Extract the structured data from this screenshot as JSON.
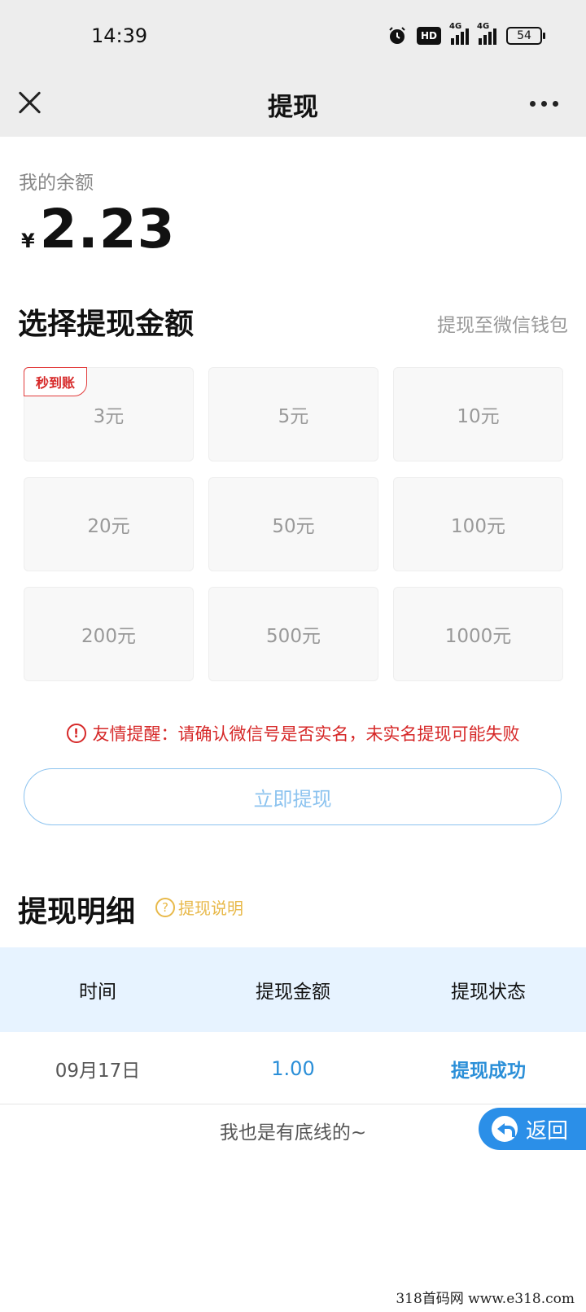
{
  "status_bar": {
    "time": "14:39",
    "hd_label": "HD",
    "net1": "4G",
    "net2": "4G",
    "battery": "54"
  },
  "nav": {
    "title": "提现"
  },
  "balance": {
    "label": "我的余额",
    "currency": "¥",
    "amount": "2.23"
  },
  "select": {
    "title": "选择提现金额",
    "destination": "提现至微信钱包",
    "instant_tag": "秒到账"
  },
  "options": [
    "3元",
    "5元",
    "10元",
    "20元",
    "50元",
    "100元",
    "200元",
    "500元",
    "1000元"
  ],
  "warning": {
    "icon": "!",
    "text": "友情提醒：请确认微信号是否实名，未实名提现可能失败"
  },
  "withdraw_button": "立即提现",
  "records": {
    "title": "提现明细",
    "help": "提现说明",
    "help_icon": "?",
    "columns": [
      "时间",
      "提现金额",
      "提现状态"
    ],
    "rows": [
      {
        "date": "09月17日",
        "amount": "1.00",
        "status": "提现成功"
      }
    ],
    "footer": "我也是有底线的~"
  },
  "back_button": "返回",
  "watermark": "318首码网 www.e318.com"
}
